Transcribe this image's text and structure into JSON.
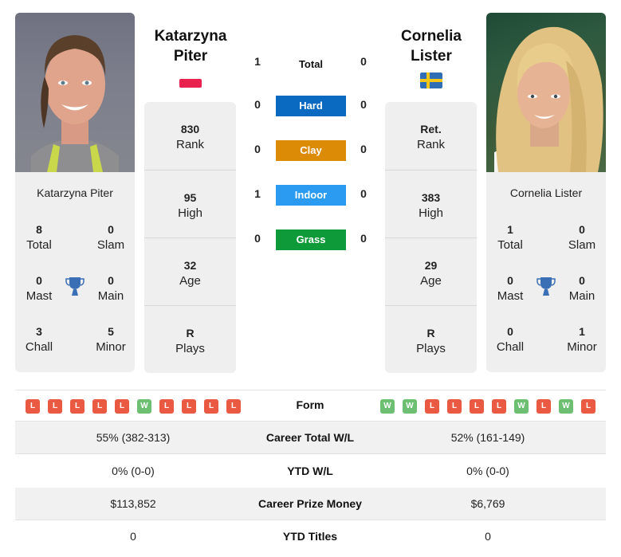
{
  "player1": {
    "name_line1": "Katarzyna",
    "name_line2": "Piter",
    "full_name": "Katarzyna Piter",
    "flag": "poland-flag",
    "titles": {
      "total": {
        "value": "8",
        "label": "Total"
      },
      "slam": {
        "value": "0",
        "label": "Slam"
      },
      "mast": {
        "value": "0",
        "label": "Mast"
      },
      "main": {
        "value": "0",
        "label": "Main"
      },
      "chall": {
        "value": "3",
        "label": "Chall"
      },
      "minor": {
        "value": "5",
        "label": "Minor"
      }
    },
    "stats": [
      {
        "value": "830",
        "label": "Rank"
      },
      {
        "value": "95",
        "label": "High"
      },
      {
        "value": "32",
        "label": "Age"
      },
      {
        "value": "R",
        "label": "Plays"
      }
    ],
    "form": [
      "L",
      "L",
      "L",
      "L",
      "L",
      "W",
      "L",
      "L",
      "L",
      "L"
    ]
  },
  "player2": {
    "name_line1": "Cornelia",
    "name_line2": "Lister",
    "full_name": "Cornelia Lister",
    "flag": "sweden-flag",
    "titles": {
      "total": {
        "value": "1",
        "label": "Total"
      },
      "slam": {
        "value": "0",
        "label": "Slam"
      },
      "mast": {
        "value": "0",
        "label": "Mast"
      },
      "main": {
        "value": "0",
        "label": "Main"
      },
      "chall": {
        "value": "0",
        "label": "Chall"
      },
      "minor": {
        "value": "1",
        "label": "Minor"
      }
    },
    "stats": [
      {
        "value": "Ret.",
        "label": "Rank"
      },
      {
        "value": "383",
        "label": "High"
      },
      {
        "value": "29",
        "label": "Age"
      },
      {
        "value": "R",
        "label": "Plays"
      }
    ],
    "form": [
      "W",
      "W",
      "L",
      "L",
      "L",
      "L",
      "W",
      "L",
      "W",
      "L"
    ]
  },
  "h2h": [
    {
      "label": "Total",
      "p1": "1",
      "p2": "0",
      "color": ""
    },
    {
      "label": "Hard",
      "p1": "0",
      "p2": "0",
      "color": "#0a6ac2"
    },
    {
      "label": "Clay",
      "p1": "0",
      "p2": "0",
      "color": "#dc8b06"
    },
    {
      "label": "Indoor",
      "p1": "1",
      "p2": "0",
      "color": "#2a9bf0"
    },
    {
      "label": "Grass",
      "p1": "0",
      "p2": "0",
      "color": "#0f9a3a"
    }
  ],
  "form_label": "Form",
  "comparison": [
    {
      "label": "Career Total W/L",
      "p1": "55% (382-313)",
      "p2": "52% (161-149)"
    },
    {
      "label": "YTD W/L",
      "p1": "0% (0-0)",
      "p2": "0% (0-0)"
    },
    {
      "label": "Career Prize Money",
      "p1": "$113,852",
      "p2": "$6,769"
    },
    {
      "label": "YTD Titles",
      "p1": "0",
      "p2": "0"
    }
  ],
  "colors": {
    "loss": "#ea5a43",
    "win": "#6dbf71",
    "trophy": "#3a6fb5",
    "card_bg": "#efefef"
  }
}
